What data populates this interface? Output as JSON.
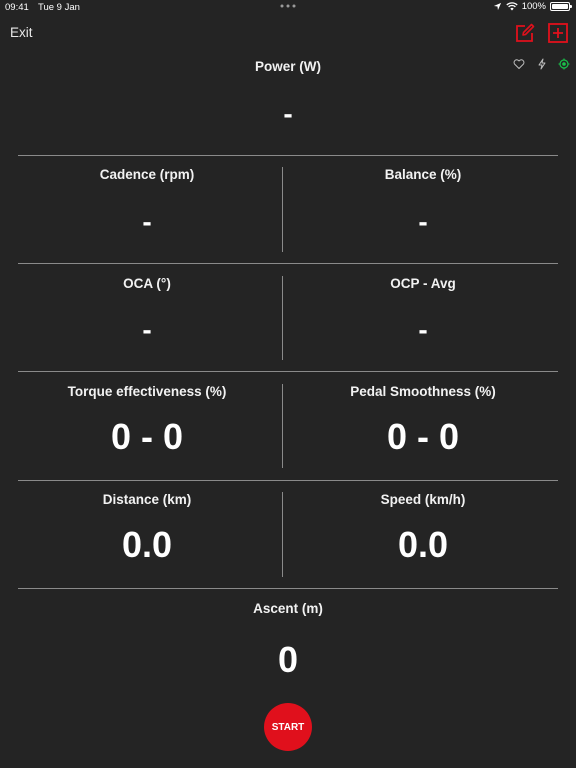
{
  "status_bar": {
    "time": "09:41",
    "date": "Tue 9 Jan",
    "battery": "100%"
  },
  "nav": {
    "exit_label": "Exit"
  },
  "colors": {
    "accent_red": "#e0101c",
    "status_green": "#19c24a",
    "background": "#242424"
  },
  "metrics": {
    "power": {
      "label": "Power (W)",
      "value": "-"
    },
    "cadence": {
      "label": "Cadence (rpm)",
      "value": "-"
    },
    "balance": {
      "label": "Balance (%)",
      "value": "-"
    },
    "oca": {
      "label": "OCA (°)",
      "value": "-"
    },
    "ocp": {
      "label": "OCP - Avg",
      "value": "-"
    },
    "torque": {
      "label": "Torque effectiveness (%)",
      "value": "0 - 0"
    },
    "smoothness": {
      "label": "Pedal Smoothness (%)",
      "value": "0 - 0"
    },
    "distance": {
      "label": "Distance (km)",
      "value": "0.0"
    },
    "speed": {
      "label": "Speed (km/h)",
      "value": "0.0"
    },
    "ascent": {
      "label": "Ascent (m)",
      "value": "0"
    }
  },
  "actions": {
    "start_label": "START"
  },
  "icons": {
    "edit": "edit-icon",
    "add": "add-icon",
    "heart": "heart-icon",
    "bolt": "bolt-icon",
    "gps": "gps-icon"
  }
}
